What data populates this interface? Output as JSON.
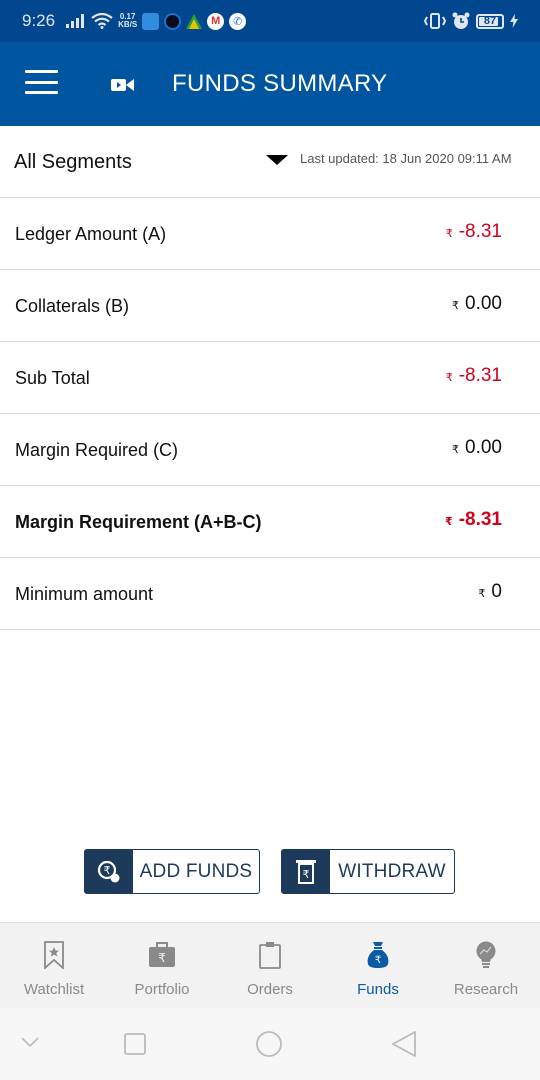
{
  "status_bar": {
    "time": "9:26",
    "net_speed_value": "0.17",
    "net_speed_unit": "KB/S",
    "battery_level": "87",
    "battery_percent": 87
  },
  "app_bar": {
    "title": "FUNDS SUMMARY",
    "menu_icon": "hamburger-icon",
    "video_icon": "video-camera-icon"
  },
  "segment": {
    "selected": "All Segments",
    "last_updated": "Last updated: 18 Jun 2020 09:11 AM"
  },
  "currency_symbol": "₹",
  "rows": [
    {
      "label": "Ledger Amount (A)",
      "value": "-8.31",
      "negative": true,
      "bold": false
    },
    {
      "label": "Collaterals (B)",
      "value": "0.00",
      "negative": false,
      "bold": false
    },
    {
      "label": "Sub Total",
      "value": "-8.31",
      "negative": true,
      "bold": false
    },
    {
      "label": "Margin Required (C)",
      "value": "0.00",
      "negative": false,
      "bold": false
    },
    {
      "label": "Margin Requirement (A+B-C)",
      "value": "-8.31",
      "negative": true,
      "bold": true
    },
    {
      "label": "Minimum amount",
      "value": "0",
      "negative": false,
      "bold": false
    }
  ],
  "actions": {
    "add_funds": "ADD FUNDS",
    "withdraw": "WITHDRAW"
  },
  "bottom_nav": [
    {
      "label": "Watchlist",
      "icon": "bookmark-star-icon",
      "active": false
    },
    {
      "label": "Portfolio",
      "icon": "briefcase-rupee-icon",
      "active": false
    },
    {
      "label": "Orders",
      "icon": "clipboard-icon",
      "active": false
    },
    {
      "label": "Funds",
      "icon": "money-bag-icon",
      "active": true
    },
    {
      "label": "Research",
      "icon": "lightbulb-icon",
      "active": false
    }
  ],
  "colors": {
    "brand_blue": "#0055a1",
    "status_blue": "#00478f",
    "negative_red": "#d0021b",
    "button_navy": "#1e3a5a",
    "active_nav": "#0b5aa8"
  }
}
